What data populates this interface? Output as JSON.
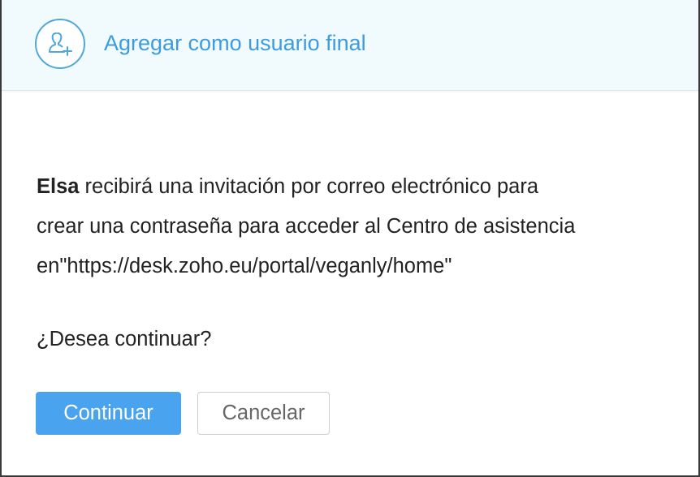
{
  "dialog": {
    "title": "Agregar como usuario final",
    "title_icon": "add-user-icon",
    "message": {
      "name": "Elsa",
      "line1_rest": " recibirá una invitación por correo electrónico para",
      "line2": "crear una contraseña para acceder al Centro de asistencia",
      "line3": "en\"https://desk.zoho.eu/portal/veganly/home\""
    },
    "question": "¿Desea continuar?",
    "buttons": {
      "continue_label": "Continuar",
      "cancel_label": "Cancelar"
    }
  },
  "colors": {
    "accent": "#3d9be0",
    "primary_button": "#4aa3ee",
    "header_background": "#f1fafd",
    "text": "#222222"
  }
}
